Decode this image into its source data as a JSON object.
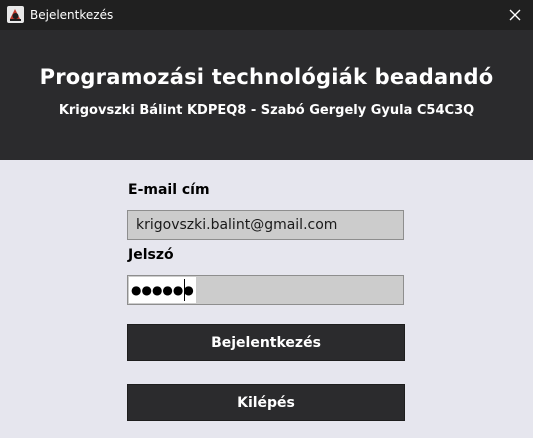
{
  "window": {
    "title": "Bejelentkezés",
    "icon": "java-app-icon",
    "close_icon": "close-icon"
  },
  "header": {
    "title": "Programozási technológiák beadandó",
    "subtitle": "Krigovszki Bálint KDPEQ8 - Szabó Gergely Gyula C54C3Q"
  },
  "form": {
    "email_label": "E-mail cím",
    "email_value": "krigovszki.balint@gmail.com",
    "password_label": "Jelszó",
    "password_mask": "●●●●●●"
  },
  "buttons": {
    "login_label": "Bejelentkezés",
    "exit_label": "Kilépés"
  },
  "colors": {
    "titlebar": "#202020",
    "header": "#2b2b2d",
    "background": "#e6e6ee",
    "field": "#cccccc",
    "button": "#2b2b2d"
  }
}
